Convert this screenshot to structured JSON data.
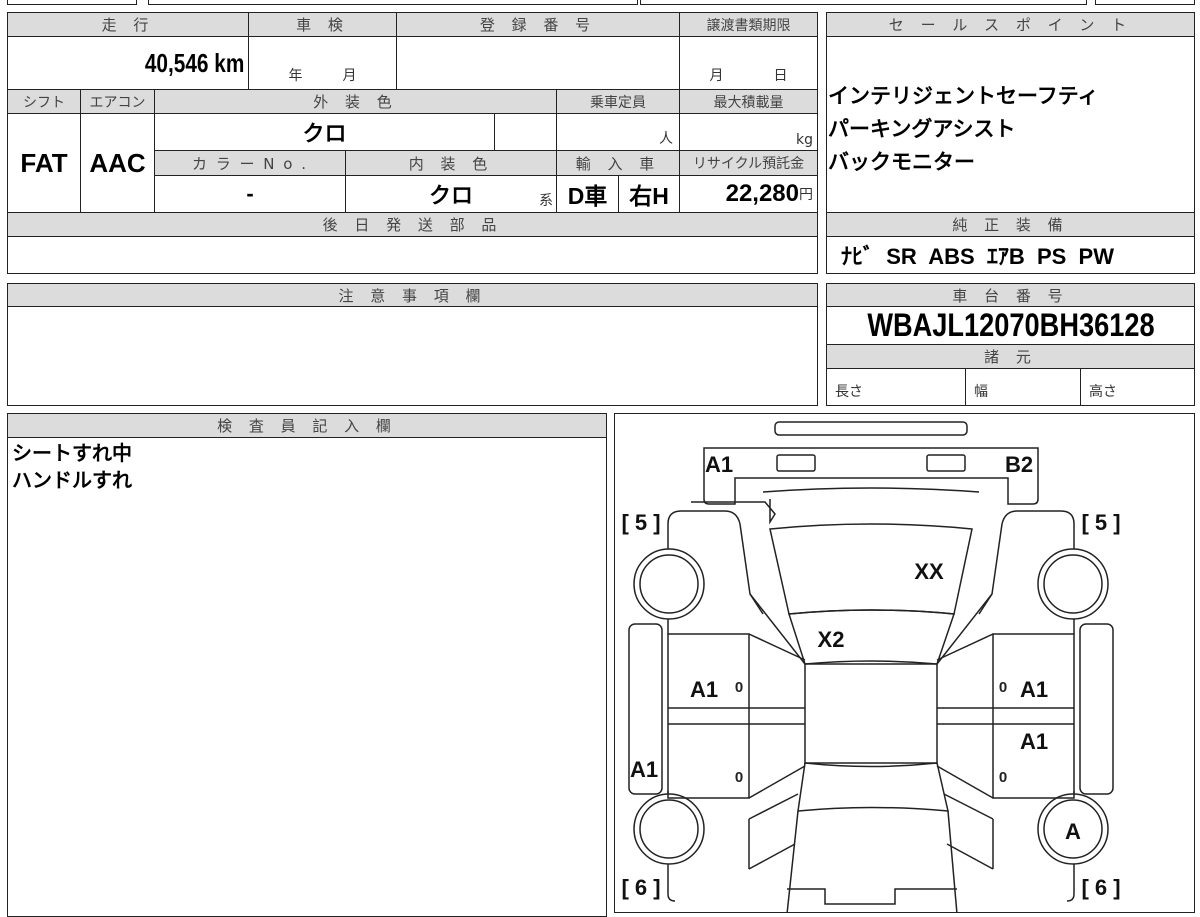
{
  "main_table": {
    "mileage_label": "走 行",
    "mileage_value": "40,546 km",
    "shaken_label": "車 検",
    "shaken_year": "年",
    "shaken_month": "月",
    "registration_label": "登 録 番 号",
    "transfer_deadline_label": "譲渡書類期限",
    "transfer_month": "月",
    "transfer_day": "日",
    "shift_label": "シフト",
    "shift_value": "FAT",
    "aircon_label": "エアコン",
    "aircon_value": "AAC",
    "exterior_color_label": "外 装 色",
    "exterior_color_value": "クロ",
    "capacity_label": "乗車定員",
    "capacity_unit": "人",
    "max_load_label": "最大積載量",
    "max_load_unit": "kg",
    "color_no_label": "カ ラ ー N o .",
    "color_no_value": "-",
    "interior_color_label": "内 装 色",
    "interior_color_value": "クロ",
    "interior_color_suffix": "系",
    "import_label": "輸 入 車",
    "import_dealer": "D車",
    "import_handle": "右H",
    "recycle_label": "リサイクル預託金",
    "recycle_value": "22,280",
    "recycle_unit": "円",
    "later_parts_label": "後 日 発 送 部 品"
  },
  "sales_point": {
    "label": "セ ー ル ス ポ イ ン ト",
    "items": [
      "インテリジェントセーフティ",
      "パーキングアシスト",
      "バックモニター"
    ]
  },
  "equipment": {
    "label": "純 正 装 備",
    "value": "ﾅﾋﾞ  SR  ABS  ｴｱB  PS  PW"
  },
  "caution": {
    "label": "注 意 事 項 欄"
  },
  "chassis": {
    "label": "車 台 番 号",
    "value": "WBAJL12070BH36128",
    "specs_label": "諸 元",
    "length_label": "長さ",
    "width_label": "幅",
    "height_label": "高さ"
  },
  "inspector": {
    "label": "検 査 員 記 入 欄",
    "notes": [
      "シートすれ中",
      "ハンドルすれ"
    ]
  },
  "diagram": {
    "front_left": "A1",
    "front_right": "B2",
    "tire_front_left": "[ 5 ]",
    "tire_front_right": "[ 5 ]",
    "tire_rear_left": "[ 6 ]",
    "tire_rear_right": "[ 6 ]",
    "hood": "XX",
    "windshield": "X2",
    "left_front_door": "A1",
    "right_front_door": "A1",
    "right_rear_door": "A1",
    "left_sill": "A1",
    "rear_right_wheel": "A",
    "door_marks": [
      "0",
      "0",
      "0",
      "0"
    ]
  }
}
